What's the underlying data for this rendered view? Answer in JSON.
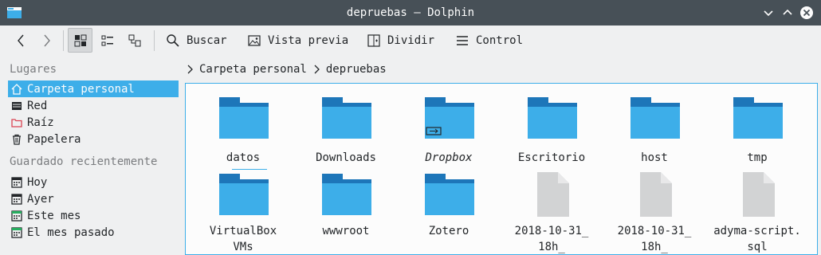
{
  "window": {
    "title": "depruebas — Dolphin"
  },
  "toolbar": {
    "back_icon": "arrow-left-icon",
    "forward_icon": "arrow-right-icon",
    "view_icons": "icons-view-icon",
    "view_compact": "compact-view-icon",
    "view_details": "details-view-icon",
    "search_label": "Buscar",
    "preview_label": "Vista previa",
    "split_label": "Dividir",
    "control_label": "Control"
  },
  "sidebar": {
    "places_title": "Lugares",
    "places": [
      {
        "label": "Carpeta personal",
        "icon": "home-icon",
        "selected": true
      },
      {
        "label": "Red",
        "icon": "network-icon"
      },
      {
        "label": "Raíz",
        "icon": "root-folder-icon"
      },
      {
        "label": "Papelera",
        "icon": "trash-icon"
      }
    ],
    "recent_title": "Guardado recientemente",
    "recent": [
      {
        "label": "Hoy",
        "icon": "calendar-icon"
      },
      {
        "label": "Ayer",
        "icon": "calendar-icon"
      },
      {
        "label": "Este mes",
        "icon": "calendar-icon"
      },
      {
        "label": "El mes pasado",
        "icon": "calendar-icon"
      }
    ]
  },
  "breadcrumb": {
    "items": [
      "Carpeta personal",
      "depruebas"
    ]
  },
  "files": [
    {
      "name": "datos",
      "type": "folder"
    },
    {
      "name": "Downloads",
      "type": "folder"
    },
    {
      "name": "Dropbox",
      "type": "folder-link"
    },
    {
      "name": "Escritorio",
      "type": "folder"
    },
    {
      "name": "host",
      "type": "folder"
    },
    {
      "name": "tmp",
      "type": "folder"
    },
    {
      "name": "VirtualBox VMs",
      "line1": "VirtualBox",
      "line2": "VMs",
      "type": "folder"
    },
    {
      "name": "wwwroot",
      "type": "folder"
    },
    {
      "name": "Zotero",
      "type": "folder"
    },
    {
      "name": "2018-10-31_18h_",
      "line1": "2018-10-31_",
      "line2": "18h_",
      "type": "file"
    },
    {
      "name": "2018-10-31_18h_",
      "line1": "2018-10-31_",
      "line2": "18h_",
      "type": "file"
    },
    {
      "name": "adyma-script.sql",
      "line1": "adyma-script.",
      "line2": "sql",
      "type": "file"
    }
  ],
  "colors": {
    "accent": "#3daee9",
    "folder_body": "#3daee9",
    "folder_tab": "#1d76b9",
    "titlebar": "#475057"
  }
}
